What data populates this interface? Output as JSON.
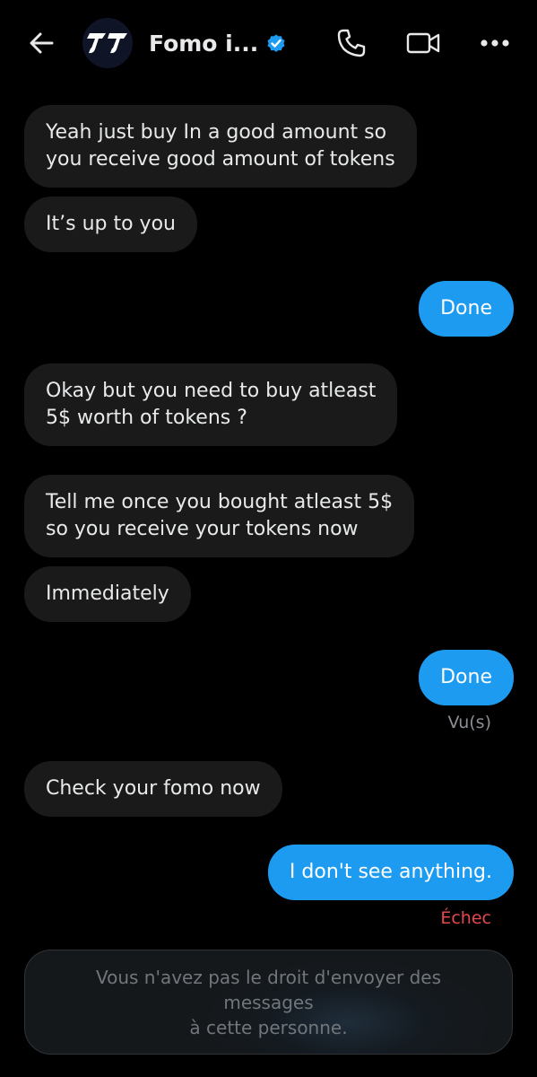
{
  "header": {
    "contact_name": "Fomo i...",
    "icons": {
      "back": "arrow-left-icon",
      "verified": "verified-badge-icon",
      "call": "phone-icon",
      "video": "video-camera-icon",
      "more": "more-horizontal-icon"
    }
  },
  "messages": [
    {
      "direction": "in",
      "text": "Yeah just buy In a good amount so\nyou receive good amount of tokens"
    },
    {
      "direction": "in",
      "text": "It’s up to you"
    },
    {
      "direction": "out",
      "text": "Done"
    },
    {
      "direction": "in",
      "text": "Okay but you need to buy atleast\n5$ worth of tokens ?"
    },
    {
      "direction": "in",
      "text": "Tell me once you bought atleast 5$\nso you receive your tokens now"
    },
    {
      "direction": "in",
      "text": "Immediately"
    },
    {
      "direction": "out",
      "text": "Done"
    },
    {
      "direction": "in",
      "text": "Check your fomo now"
    },
    {
      "direction": "out",
      "text": "I don't see anything."
    }
  ],
  "statuses": {
    "seen": "Vu(s)",
    "failed": "Échec"
  },
  "composer": {
    "restriction_text": "Vous n'avez pas le droit d'envoyer des messages\nà cette personne."
  },
  "colors": {
    "background": "#000000",
    "incoming_bubble": "#1a1a1a",
    "outgoing_bubble": "#1d9bf0",
    "verified_badge": "#1d9bf0",
    "failed_status": "#e5484d",
    "muted_text": "#71767b"
  }
}
